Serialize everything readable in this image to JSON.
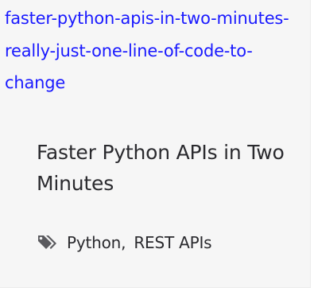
{
  "card": {
    "slug_link": "faster-python-apis-in-two-minutes-really-just-one-line-of-code-to-change",
    "title": "Faster Python APIs in Two Minutes",
    "tags_icon": "tags-icon",
    "tags": [
      {
        "label": "Python"
      },
      {
        "label": "REST APIs"
      }
    ],
    "tag_separator": ","
  },
  "colors": {
    "link": "#1a1aff",
    "text": "#2a2a2e",
    "icon": "#5a5a5e",
    "card_bg": "#f6f6f6"
  }
}
